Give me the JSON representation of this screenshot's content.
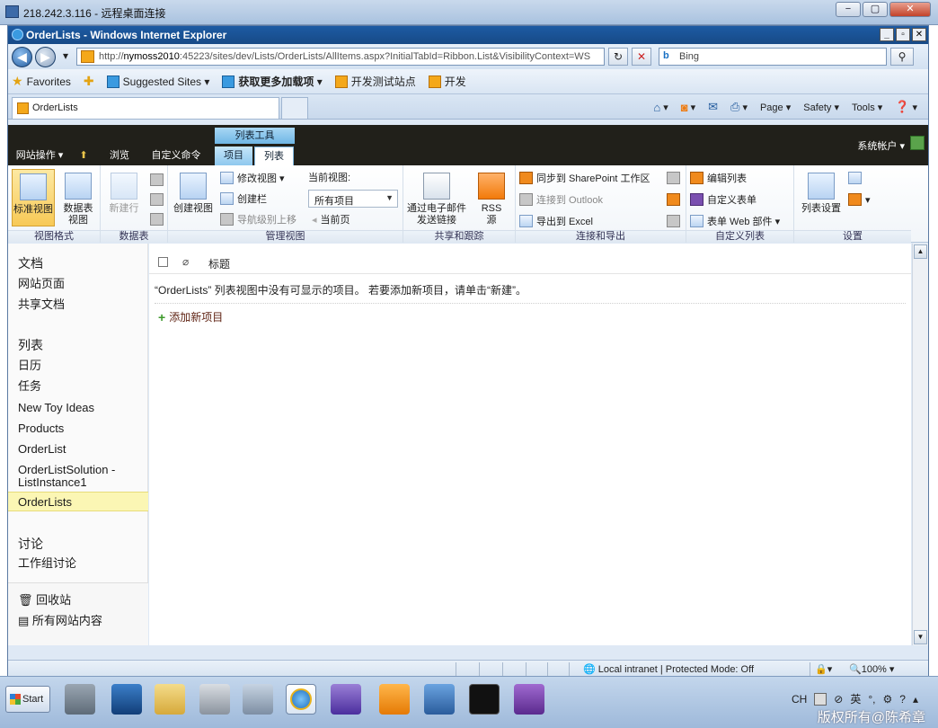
{
  "rdp": {
    "title": "218.242.3.116 - 远程桌面连接",
    "min": "−",
    "restore": "▢",
    "close": "✕"
  },
  "ie": {
    "title": "OrderLists - Windows Internet Explorer",
    "url_prefix": "http://",
    "url_host": "nymoss2010",
    "url_rest": ":45223/sites/dev/Lists/OrderLists/AllItems.aspx?InitialTabId=Ribbon.List&VisibilityContext=WS",
    "search_placeholder": "Bing",
    "favorites": [
      "Favorites",
      "Suggested Sites ▾",
      "获取更多加载项 ▾",
      "开发测试站点",
      "开发"
    ],
    "tab_title": "OrderLists",
    "commands": [
      "Page ▾",
      "Safety ▾",
      "Tools ▾"
    ],
    "status_zone": "Local intranet | Protected Mode: Off",
    "zoom": "100%"
  },
  "sp": {
    "site_actions": "网站操作 ▾",
    "tabs": [
      "浏览",
      "自定义命令"
    ],
    "ctx_header": "列表工具",
    "ctx_tabs": [
      "项目",
      "列表"
    ],
    "user": "系统帐户 ▾",
    "ribbon": {
      "groups": [
        "视图格式",
        "数据表",
        "管理视图",
        "共享和跟踪",
        "连接和导出",
        "自定义列表",
        "设置"
      ],
      "std_view": "标准视图",
      "datasheet_view": [
        "数据表",
        "视图"
      ],
      "new_row": "新建行",
      "create_view": "创建视图",
      "modify_view": "修改视图 ▾",
      "create_column": "创建栏",
      "nav_up": "导航级别上移",
      "current_view_label": "当前视图:",
      "current_view": "所有项目",
      "current_page": "当前页",
      "email_link": [
        "通过电子邮件",
        "发送链接"
      ],
      "rss": [
        "RSS",
        "源"
      ],
      "sync_sp": "同步到 SharePoint 工作区",
      "connect_outlook": "连接到 Outlook",
      "export_excel": "导出到 Excel",
      "edit_list": "编辑列表",
      "custom_form": "自定义表单",
      "form_webparts": "表单 Web 部件 ▾",
      "list_settings": "列表设置"
    },
    "quicklaunch": {
      "docs_header": "文档",
      "docs": [
        "网站页面",
        "共享文档"
      ],
      "lists_header": "列表",
      "lists": [
        "日历",
        "任务",
        "New Toy Ideas",
        "Products",
        "OrderList",
        "OrderListSolution -",
        "ListInstance1",
        "OrderLists"
      ],
      "discuss_header": "讨论",
      "discuss": [
        "工作组讨论"
      ],
      "recycle": "回收站",
      "all_content": "所有网站内容"
    },
    "list": {
      "col_title": "标题",
      "empty_message": "“OrderLists” 列表视图中没有可显示的项目。 若要添加新项目，请单击“新建”。",
      "add_new": "添加新项目"
    }
  },
  "taskbar": {
    "start": "Start",
    "lang": "CH",
    "ime": "英",
    "watermark": "版权所有@陈希章"
  }
}
